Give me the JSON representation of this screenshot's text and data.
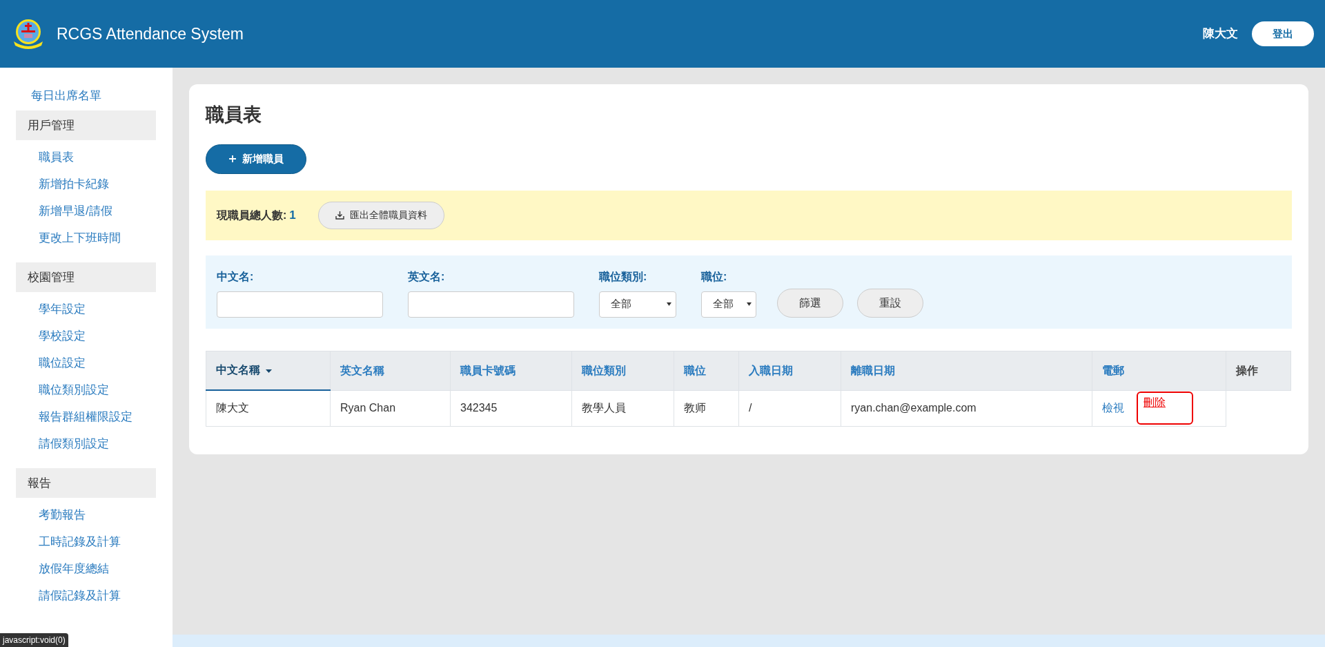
{
  "header": {
    "title": "RCGS Attendance System",
    "user": "陳大文",
    "logout": "登出"
  },
  "sidebar": {
    "top_link": "每日出席名單",
    "sections": [
      {
        "title": "用戶管理",
        "items": [
          "職員表",
          "新增拍卡紀錄",
          "新增早退/請假",
          "更改上下班時間"
        ]
      },
      {
        "title": "校園管理",
        "items": [
          "學年設定",
          "學校設定",
          "職位設定",
          "職位類別設定",
          "報告群組權限設定",
          "請假類別設定"
        ]
      },
      {
        "title": "報告",
        "items": [
          "考勤報告",
          "工時記錄及計算",
          "放假年度總結",
          "請假記錄及計算"
        ]
      }
    ]
  },
  "page": {
    "title": "職員表",
    "add_button": "新增職員"
  },
  "summary": {
    "label": "現職員總人數:",
    "count": "1",
    "export_button": "匯出全體職員資料"
  },
  "filters": {
    "fields": [
      {
        "kind": "text",
        "label": "中文名:"
      },
      {
        "kind": "text",
        "label": "英文名:"
      },
      {
        "kind": "select",
        "label": "職位類別:",
        "value": "全部"
      },
      {
        "kind": "select",
        "label": "職位:",
        "value": "全部"
      }
    ],
    "buttons": [
      "篩選",
      "重設"
    ]
  },
  "table": {
    "columns": [
      {
        "label": "中文名稱",
        "sorted": true
      },
      {
        "label": "英文名稱",
        "sorted": false
      },
      {
        "label": "職員卡號碼",
        "sorted": false
      },
      {
        "label": "職位類別",
        "sorted": false
      },
      {
        "label": "職位",
        "sorted": false
      },
      {
        "label": "入職日期",
        "sorted": false
      },
      {
        "label": "離職日期",
        "sorted": false
      },
      {
        "label": "電郵",
        "sorted": false
      },
      {
        "label": "操作",
        "sorted": false
      }
    ],
    "rows": [
      {
        "cells": [
          "陳大文",
          "Ryan Chan",
          "342345",
          "教學人員",
          "教师",
          "/",
          "ryan.chan@example.com"
        ],
        "actions": [
          {
            "kind": "view",
            "label": "檢視",
            "highlighted": false
          },
          {
            "kind": "delete",
            "label": "刪除",
            "highlighted": true
          }
        ]
      }
    ]
  },
  "status_bar": "javascript:void(0)"
}
